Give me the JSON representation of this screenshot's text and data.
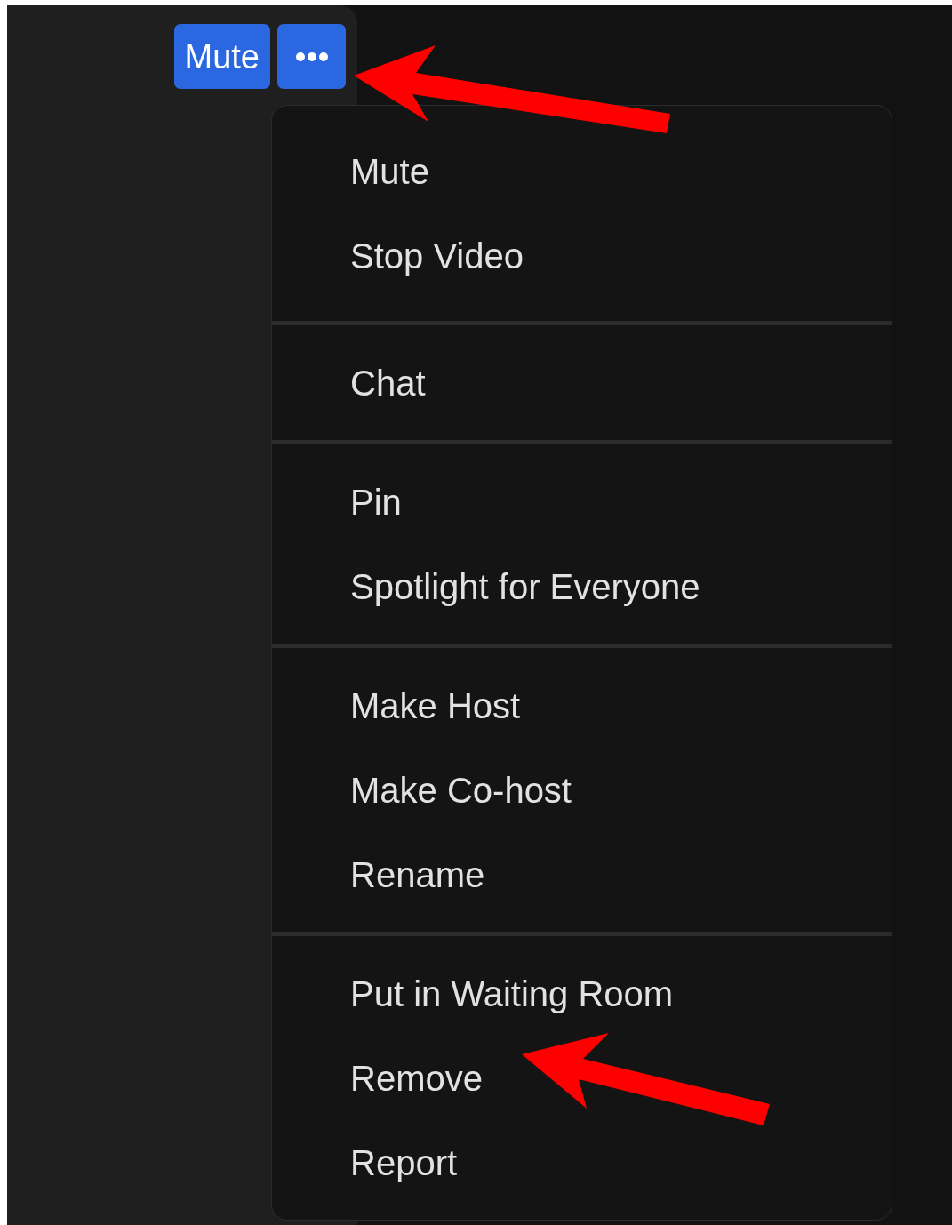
{
  "participant_controls": {
    "mute_button": "Mute"
  },
  "context_menu": {
    "groups": [
      {
        "items": [
          "Mute",
          "Stop Video"
        ]
      },
      {
        "items": [
          "Chat"
        ]
      },
      {
        "items": [
          "Pin",
          "Spotlight for Everyone"
        ]
      },
      {
        "items": [
          "Make Host",
          "Make Co-host",
          "Rename"
        ]
      },
      {
        "items": [
          "Put in Waiting Room",
          "Remove",
          "Report"
        ]
      }
    ]
  }
}
